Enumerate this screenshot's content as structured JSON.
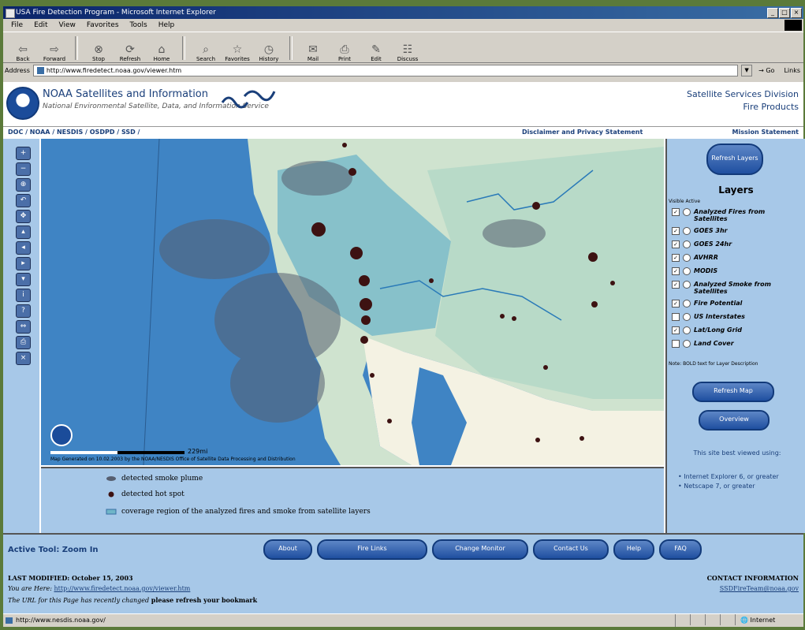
{
  "window": {
    "title": "USA Fire Detection Program - Microsoft Internet Explorer",
    "controls": [
      "_",
      "□",
      "×"
    ]
  },
  "menu": [
    "File",
    "Edit",
    "View",
    "Favorites",
    "Tools",
    "Help"
  ],
  "toolbar": [
    {
      "label": "Back",
      "icon": "back-arrow-icon",
      "glyph": "⇦"
    },
    {
      "label": "Forward",
      "icon": "forward-arrow-icon",
      "glyph": "⇨"
    },
    {
      "label": "Stop",
      "icon": "stop-icon",
      "glyph": "⊗"
    },
    {
      "label": "Refresh",
      "icon": "refresh-icon",
      "glyph": "⟳"
    },
    {
      "label": "Home",
      "icon": "home-icon",
      "glyph": "⌂"
    },
    {
      "label": "Search",
      "icon": "search-icon",
      "glyph": "⌕"
    },
    {
      "label": "Favorites",
      "icon": "favorites-icon",
      "glyph": "☆"
    },
    {
      "label": "History",
      "icon": "history-icon",
      "glyph": "◷"
    },
    {
      "label": "Mail",
      "icon": "mail-icon",
      "glyph": "✉"
    },
    {
      "label": "Print",
      "icon": "print-icon",
      "glyph": "⎙"
    },
    {
      "label": "Edit",
      "icon": "edit-icon",
      "glyph": "✎"
    },
    {
      "label": "Discuss",
      "icon": "discuss-icon",
      "glyph": "☷"
    }
  ],
  "address": {
    "label": "Address",
    "url": "http://www.firedetect.noaa.gov/viewer.htm",
    "go": "Go",
    "links": "Links"
  },
  "header": {
    "title": "NOAA Satellites and Information",
    "subtitle": "National Environmental Satellite, Data, and Information Service",
    "right_line1": "Satellite Services Division",
    "right_line2": "Fire Products"
  },
  "nav": {
    "breadcrumb": "DOC / NOAA / NESDIS / OSDPD / SSD /",
    "disclaimer": "Disclaimer and Privacy Statement",
    "mission": "Mission Statement"
  },
  "map": {
    "scale_label": "229mi",
    "credit": "Map Generated on 10.02.2003 by the NOAA/NESDIS Office of Satellite Data Processing and Distribution"
  },
  "legend": {
    "smoke": "detected smoke plume",
    "hotspot": "detected hot spot",
    "coverage": "coverage region of the analyzed fires and smoke from satellite layers"
  },
  "panel": {
    "refresh_button": "Refresh Layers",
    "layers_title": "Layers",
    "layers_header": "Visible Active",
    "layers": [
      {
        "label": "Analyzed Fires from Satellites",
        "checked": true,
        "two_lines": true
      },
      {
        "label": "GOES 3hr",
        "checked": true
      },
      {
        "label": "GOES 24hr",
        "checked": true
      },
      {
        "label": "AVHRR",
        "checked": true
      },
      {
        "label": "MODIS",
        "checked": true
      },
      {
        "label": "Analyzed Smoke from Satellites",
        "checked": true,
        "two_lines": true
      },
      {
        "label": "Fire Potential",
        "checked": true
      },
      {
        "label": "US Interstates",
        "checked": false
      },
      {
        "label": "Lat/Long Grid",
        "checked": true
      },
      {
        "label": "Land Cover",
        "checked": false
      }
    ],
    "bold_note": "Note: BOLD text for Layer Description",
    "btn1": "Refresh Map",
    "btn2": "Overview",
    "best_viewed": "This site best viewed using:",
    "browser1": "Internet Explorer 6, or greater",
    "browser2": "Netscape 7, or greater"
  },
  "bottom": {
    "active_tool": "Active Tool: Zoom In",
    "buttons": [
      "About",
      "Fire Links",
      "Change Monitor",
      "Contact Us",
      "Help",
      "FAQ"
    ],
    "last_modified": "LAST MODIFIED: October 15, 2003",
    "you_are_here_prefix": "You are Here:",
    "you_are_here_link": "http://www.firedetect.noaa.gov/viewer.htm",
    "url_notice": "The URL for this Page has recently changed",
    "url_notice_bold": "please refresh your bookmark",
    "contact_title": "CONTACT INFORMATION",
    "contact_email": "SSDFireTeam@noaa.gov"
  },
  "status": {
    "url": "http://www.nesdis.noaa.gov/",
    "zone": "Internet"
  },
  "colors": {
    "panel": "#a7c8e8",
    "button": "#1f4fa0",
    "ocean": "#3f84c4",
    "land": "#cfe3cf",
    "coverage": "#6fb5c8",
    "hotspot": "#3d1212"
  }
}
